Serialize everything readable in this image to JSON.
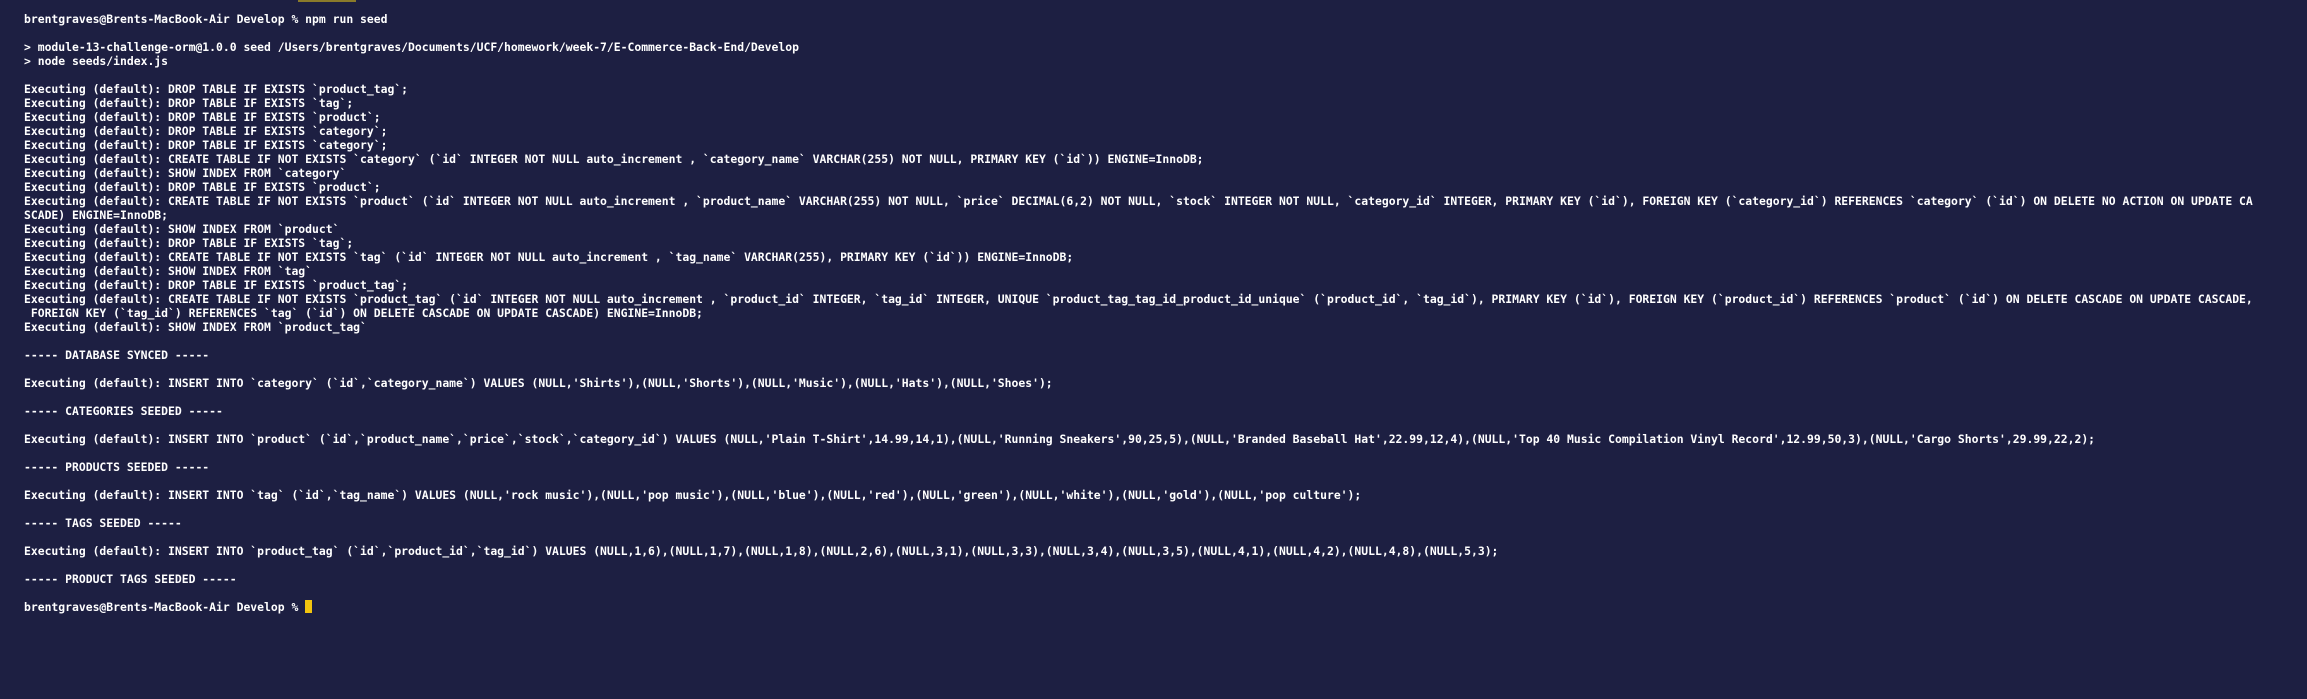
{
  "terminal": {
    "prompt": "brentgraves@Brents-MacBook-Air Develop %",
    "command": "npm run seed",
    "lines": [
      {
        "type": "prompt",
        "text": "brentgraves@Brents-MacBook-Air Develop % npm run seed"
      },
      {
        "type": "blank",
        "text": ""
      },
      {
        "type": "output",
        "text": "> module-13-challenge-orm@1.0.0 seed /Users/brentgraves/Documents/UCF/homework/week-7/E-Commerce-Back-End/Develop"
      },
      {
        "type": "output",
        "text": "> node seeds/index.js"
      },
      {
        "type": "blank",
        "text": ""
      },
      {
        "type": "output",
        "text": "Executing (default): DROP TABLE IF EXISTS `product_tag`;"
      },
      {
        "type": "output",
        "text": "Executing (default): DROP TABLE IF EXISTS `tag`;"
      },
      {
        "type": "output",
        "text": "Executing (default): DROP TABLE IF EXISTS `product`;"
      },
      {
        "type": "output",
        "text": "Executing (default): DROP TABLE IF EXISTS `category`;"
      },
      {
        "type": "output",
        "text": "Executing (default): DROP TABLE IF EXISTS `category`;"
      },
      {
        "type": "output",
        "text": "Executing (default): CREATE TABLE IF NOT EXISTS `category` (`id` INTEGER NOT NULL auto_increment , `category_name` VARCHAR(255) NOT NULL, PRIMARY KEY (`id`)) ENGINE=InnoDB;"
      },
      {
        "type": "output",
        "text": "Executing (default): SHOW INDEX FROM `category`"
      },
      {
        "type": "output",
        "text": "Executing (default): DROP TABLE IF EXISTS `product`;"
      },
      {
        "type": "output",
        "text": "Executing (default): CREATE TABLE IF NOT EXISTS `product` (`id` INTEGER NOT NULL auto_increment , `product_name` VARCHAR(255) NOT NULL, `price` DECIMAL(6,2) NOT NULL, `stock` INTEGER NOT NULL, `category_id` INTEGER, PRIMARY KEY (`id`), FOREIGN KEY (`category_id`) REFERENCES `category` (`id`) ON DELETE NO ACTION ON UPDATE CA"
      },
      {
        "type": "output",
        "text": "SCADE) ENGINE=InnoDB;"
      },
      {
        "type": "output",
        "text": "Executing (default): SHOW INDEX FROM `product`"
      },
      {
        "type": "output",
        "text": "Executing (default): DROP TABLE IF EXISTS `tag`;"
      },
      {
        "type": "output",
        "text": "Executing (default): CREATE TABLE IF NOT EXISTS `tag` (`id` INTEGER NOT NULL auto_increment , `tag_name` VARCHAR(255), PRIMARY KEY (`id`)) ENGINE=InnoDB;"
      },
      {
        "type": "output",
        "text": "Executing (default): SHOW INDEX FROM `tag`"
      },
      {
        "type": "output",
        "text": "Executing (default): DROP TABLE IF EXISTS `product_tag`;"
      },
      {
        "type": "output",
        "text": "Executing (default): CREATE TABLE IF NOT EXISTS `product_tag` (`id` INTEGER NOT NULL auto_increment , `product_id` INTEGER, `tag_id` INTEGER, UNIQUE `product_tag_tag_id_product_id_unique` (`product_id`, `tag_id`), PRIMARY KEY (`id`), FOREIGN KEY (`product_id`) REFERENCES `product` (`id`) ON DELETE CASCADE ON UPDATE CASCADE,"
      },
      {
        "type": "output",
        "text": " FOREIGN KEY (`tag_id`) REFERENCES `tag` (`id`) ON DELETE CASCADE ON UPDATE CASCADE) ENGINE=InnoDB;"
      },
      {
        "type": "output",
        "text": "Executing (default): SHOW INDEX FROM `product_tag`"
      },
      {
        "type": "blank",
        "text": ""
      },
      {
        "type": "output",
        "text": "----- DATABASE SYNCED -----"
      },
      {
        "type": "blank",
        "text": ""
      },
      {
        "type": "output",
        "text": "Executing (default): INSERT INTO `category` (`id`,`category_name`) VALUES (NULL,'Shirts'),(NULL,'Shorts'),(NULL,'Music'),(NULL,'Hats'),(NULL,'Shoes');"
      },
      {
        "type": "blank",
        "text": ""
      },
      {
        "type": "output",
        "text": "----- CATEGORIES SEEDED -----"
      },
      {
        "type": "blank",
        "text": ""
      },
      {
        "type": "output",
        "text": "Executing (default): INSERT INTO `product` (`id`,`product_name`,`price`,`stock`,`category_id`) VALUES (NULL,'Plain T-Shirt',14.99,14,1),(NULL,'Running Sneakers',90,25,5),(NULL,'Branded Baseball Hat',22.99,12,4),(NULL,'Top 40 Music Compilation Vinyl Record',12.99,50,3),(NULL,'Cargo Shorts',29.99,22,2);"
      },
      {
        "type": "blank",
        "text": ""
      },
      {
        "type": "output",
        "text": "----- PRODUCTS SEEDED -----"
      },
      {
        "type": "blank",
        "text": ""
      },
      {
        "type": "output",
        "text": "Executing (default): INSERT INTO `tag` (`id`,`tag_name`) VALUES (NULL,'rock music'),(NULL,'pop music'),(NULL,'blue'),(NULL,'red'),(NULL,'green'),(NULL,'white'),(NULL,'gold'),(NULL,'pop culture');"
      },
      {
        "type": "blank",
        "text": ""
      },
      {
        "type": "output",
        "text": "----- TAGS SEEDED -----"
      },
      {
        "type": "blank",
        "text": ""
      },
      {
        "type": "output",
        "text": "Executing (default): INSERT INTO `product_tag` (`id`,`product_id`,`tag_id`) VALUES (NULL,1,6),(NULL,1,7),(NULL,1,8),(NULL,2,6),(NULL,3,1),(NULL,3,3),(NULL,3,4),(NULL,3,5),(NULL,4,1),(NULL,4,2),(NULL,4,8),(NULL,5,3);"
      },
      {
        "type": "blank",
        "text": ""
      },
      {
        "type": "output",
        "text": "----- PRODUCT TAGS SEEDED -----"
      },
      {
        "type": "blank",
        "text": ""
      },
      {
        "type": "current-prompt",
        "text": "brentgraves@Brents-MacBook-Air Develop % "
      }
    ]
  },
  "colors": {
    "background": "#1d1f42",
    "foreground": "#ffffff",
    "cursor": "#f2c40f"
  }
}
